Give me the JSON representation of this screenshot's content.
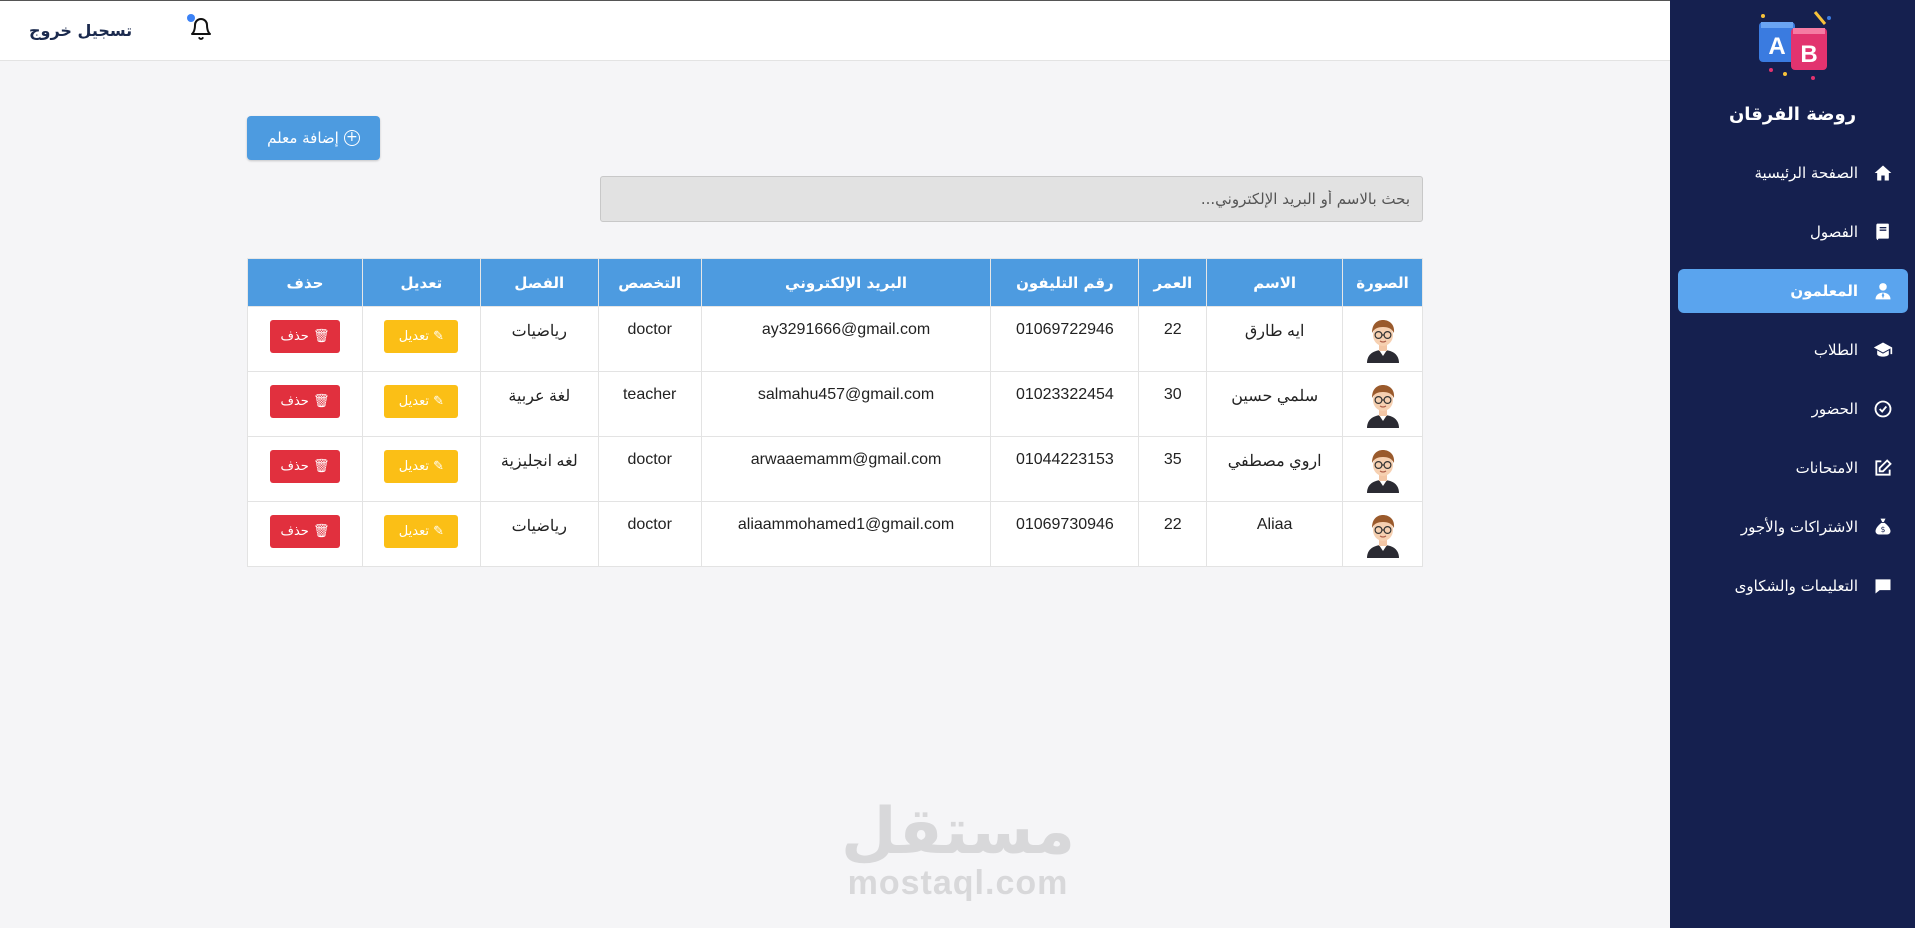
{
  "header": {
    "logout_label": "تسجيل خروج"
  },
  "sidebar": {
    "school_name": "روضة الفرقان",
    "logo_letters": [
      "A",
      "B"
    ],
    "items": [
      {
        "label": "الصفحة الرئيسية",
        "icon": "home-icon",
        "active": false
      },
      {
        "label": "الفصول",
        "icon": "book-icon",
        "active": false
      },
      {
        "label": "المعلمون",
        "icon": "teacher-icon",
        "active": true
      },
      {
        "label": "الطلاب",
        "icon": "graduation-cap-icon",
        "active": false
      },
      {
        "label": "الحضور",
        "icon": "check-circle-icon",
        "active": false
      },
      {
        "label": "الامتحانات",
        "icon": "edit-icon",
        "active": false
      },
      {
        "label": "الاشتراكات والأجور",
        "icon": "money-bag-icon",
        "active": false
      },
      {
        "label": "التعليمات والشكاوى",
        "icon": "comment-icon",
        "active": false
      }
    ]
  },
  "main": {
    "add_button_label": "إضافة معلم",
    "search_placeholder": "بحث بالاسم أو البريد الإلكتروني...",
    "table": {
      "headers": [
        "الصورة",
        "الاسم",
        "العمر",
        "رقم التليفون",
        "البريد الإلكتروني",
        "التخصص",
        "الفصل",
        "تعديل",
        "حذف"
      ],
      "edit_label": "تعديل",
      "delete_label": "حذف",
      "rows": [
        {
          "name": "ايه طارق",
          "age": "22",
          "phone": "01069722946",
          "email": "ay3291666@gmail.com",
          "specialty": "doctor",
          "class": "رياضيات"
        },
        {
          "name": "سلمي حسين",
          "age": "30",
          "phone": "01023322454",
          "email": "salmahu457@gmail.com",
          "specialty": "teacher",
          "class": "لغة عربية"
        },
        {
          "name": "اروي مصطفي",
          "age": "35",
          "phone": "01044223153",
          "email": "arwaaemamm@gmail.com",
          "specialty": "doctor",
          "class": "لغه انجليزية"
        },
        {
          "name": "Aliaa",
          "age": "22",
          "phone": "01069730946",
          "email": "aliaammohamed1@gmail.com",
          "specialty": "doctor",
          "class": "رياضيات"
        }
      ]
    }
  },
  "watermark": {
    "arabic": "مستقل",
    "latin": "mostaql.com"
  },
  "colors": {
    "sidebar_bg": "#15204f",
    "accent": "#4d9be0",
    "active_nav": "#5aa4ee",
    "edit": "#fbbf16",
    "delete": "#e1303e"
  }
}
